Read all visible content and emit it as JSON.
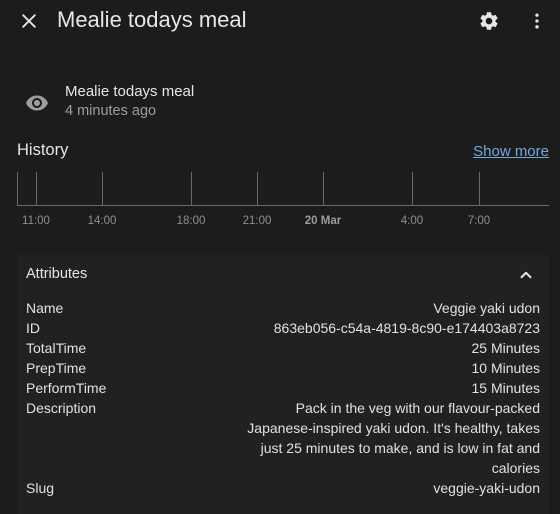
{
  "dialog": {
    "title": "Mealie todays meal"
  },
  "state": {
    "name": "Mealie todays meal",
    "last_changed": "4 minutes ago"
  },
  "history": {
    "title": "History",
    "show_more": "Show more",
    "ticks": [
      {
        "label": "11:00",
        "bold": false
      },
      {
        "label": "14:00",
        "bold": false
      },
      {
        "label": "18:00",
        "bold": false
      },
      {
        "label": "21:00",
        "bold": false
      },
      {
        "label": "20 Mar",
        "bold": true
      },
      {
        "label": "4:00",
        "bold": false
      },
      {
        "label": "7:00",
        "bold": false
      }
    ]
  },
  "attributes": {
    "title": "Attributes",
    "rows": [
      {
        "key": "Name",
        "value": "Veggie yaki udon"
      },
      {
        "key": "ID",
        "value": "863eb056-c54a-4819-8c90-e174403a8723"
      },
      {
        "key": "TotalTime",
        "value": "25 Minutes"
      },
      {
        "key": "PrepTime",
        "value": "10 Minutes"
      },
      {
        "key": "PerformTime",
        "value": "15 Minutes"
      },
      {
        "key": "Description",
        "value": "Pack in the veg with our flavour-packed Japanese-inspired yaki udon. It's healthy, takes just 25 minutes to make, and is low in fat and calories"
      },
      {
        "key": "Slug",
        "value": "veggie-yaki-udon"
      }
    ]
  },
  "icons": {
    "close": "close-icon",
    "settings": "gear-icon",
    "more": "more-vertical-icon",
    "entity": "eye-icon",
    "collapse": "chevron-up-icon"
  }
}
